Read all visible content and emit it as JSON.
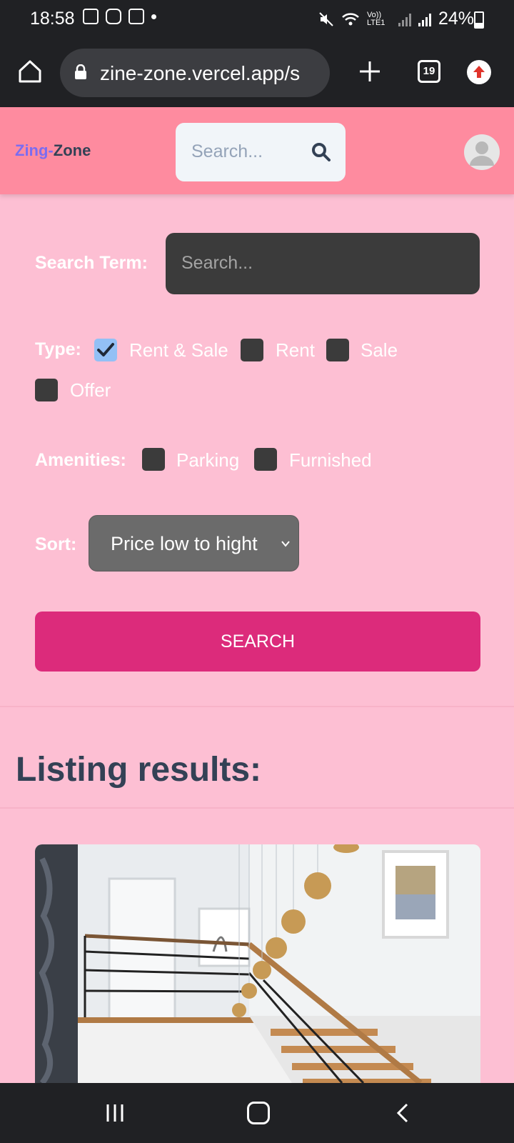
{
  "status_bar": {
    "time": "18:58",
    "lte_label": "Vo)) LTE1",
    "battery": "24%"
  },
  "browser": {
    "url": "zine-zone.vercel.app/s",
    "tab_count": "19"
  },
  "header": {
    "logo_part1": "Zing-",
    "logo_part2": "Zone",
    "search_placeholder": "Search..."
  },
  "form": {
    "search_term_label": "Search Term:",
    "search_term_placeholder": "Search...",
    "type_label": "Type:",
    "type_options": [
      {
        "label": "Rent & Sale",
        "checked": true
      },
      {
        "label": "Rent",
        "checked": false
      },
      {
        "label": "Sale",
        "checked": false
      },
      {
        "label": "Offer",
        "checked": false
      }
    ],
    "amenities_label": "Amenities:",
    "amenities_options": [
      {
        "label": "Parking",
        "checked": false
      },
      {
        "label": "Furnished",
        "checked": false
      }
    ],
    "sort_label": "Sort:",
    "sort_value": "Price low to hight",
    "search_button": "SEARCH"
  },
  "results": {
    "title": "Listing results:"
  },
  "colors": {
    "header": "#fe8b9f",
    "page": "#fdbfd3",
    "button": "#dc2b7b",
    "logo_accent": "#7b6cf0",
    "text_dark": "#334155"
  }
}
